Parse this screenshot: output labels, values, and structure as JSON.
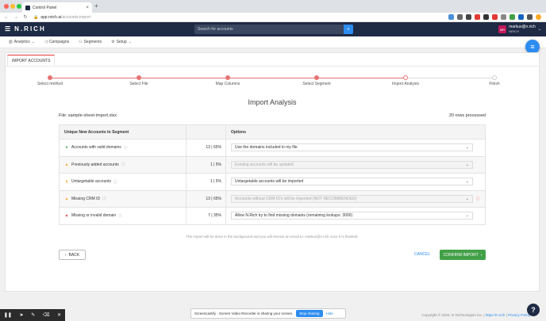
{
  "browser": {
    "tab_title": "Control Panel",
    "url_host": "app.nrich.ai",
    "url_path": "/accounts-import"
  },
  "header": {
    "logo": "N.RICH",
    "search_placeholder": "Search for accounts",
    "user_name": "markus@n.rich",
    "user_org": "NRICH",
    "avatar_initials": "MR"
  },
  "nav": {
    "items": [
      {
        "label": "Analytics",
        "icon": "bar-chart-icon"
      },
      {
        "label": "Campaigns",
        "icon": "megaphone-icon"
      },
      {
        "label": "Segments",
        "icon": "users-icon"
      },
      {
        "label": "Setup",
        "icon": "gear-icon"
      }
    ]
  },
  "page": {
    "tab_label": "IMPORT ACCOUNTS",
    "title": "Import Analysis",
    "file_label": "File: sample-sheet-import.xlsx",
    "rows_processed": "20 rows processed",
    "note": "The import will be done in the background and you will receive an email to: markus@n.rich once it is finished.",
    "back_label": "BACK",
    "cancel_label": "CANCEL",
    "confirm_label": "CONFIRM IMPORT"
  },
  "steps": [
    {
      "label": "Select method",
      "state": "done"
    },
    {
      "label": "Select File",
      "state": "done"
    },
    {
      "label": "Map Columns",
      "state": "done"
    },
    {
      "label": "Select Segment",
      "state": "done"
    },
    {
      "label": "Import Analysis",
      "state": "current"
    },
    {
      "label": "Finish",
      "state": "pending"
    }
  ],
  "table": {
    "headers": [
      "Unique New Accounts to Segment",
      "",
      "Options"
    ],
    "rows": [
      {
        "status": "ok",
        "label": "Accounts with valid domains",
        "count": "13 | 65%",
        "option": "Use the domains included in my file",
        "disabled": false,
        "alert": false
      },
      {
        "status": "warn",
        "label": "Previously added accounts",
        "count": "1 | 5%",
        "option": "Existing accounts will be updated",
        "disabled": true,
        "alert": false
      },
      {
        "status": "warn",
        "label": "Untargetable accounts",
        "count": "1 | 5%",
        "option": "Untargetable accounts will be imported",
        "disabled": false,
        "alert": false
      },
      {
        "status": "warn",
        "label": "Missing CRM ID",
        "count": "13 | 65%",
        "option": "Accounts without CRM ID's will be imported (NOT RECOMMENDED)",
        "disabled": true,
        "alert": true
      },
      {
        "status": "err",
        "label": "Missing or invalid domain",
        "count": "7 | 35%",
        "option": "Allow N.Rich try to find missing domains (remaining lookups: 3000)",
        "disabled": false,
        "alert": false
      }
    ]
  },
  "screencast": {
    "message": "Screencastify - Screen Video Recorder is sharing your screen.",
    "stop_label": "Stop sharing",
    "hide_label": "Hide"
  },
  "footer": {
    "copyright": "Copyright © 2020, N Technologies Inc.",
    "link1": "https://n.rich",
    "link2": "Privacy Policy"
  },
  "colors": {
    "header_bg": "#1f2a44",
    "accent": "#2d8cf0",
    "confirm": "#43a047",
    "stepper": "#e57373"
  }
}
